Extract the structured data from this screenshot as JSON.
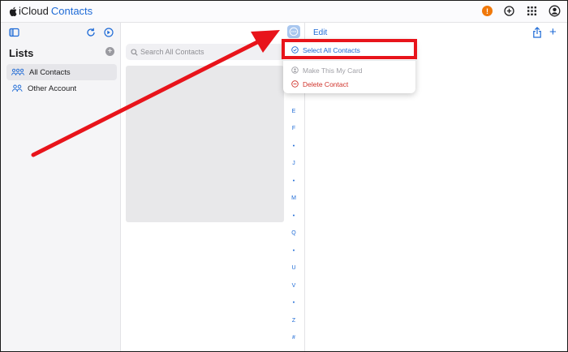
{
  "topbar": {
    "brand_icloud": "iCloud",
    "brand_app": "Contacts",
    "notification_badge": "!",
    "icons": [
      "apple-logo-icon",
      "add-circle-icon",
      "app-grid-icon",
      "account-icon"
    ]
  },
  "sidebar": {
    "lists_title": "Lists",
    "add_list_glyph": "+",
    "items": [
      {
        "label": "All Contacts",
        "selected": true,
        "icon": "people-group-icon"
      },
      {
        "label": "Other Account",
        "selected": false,
        "icon": "people-pair-icon"
      }
    ]
  },
  "contacts": {
    "search_placeholder": "Search All Contacts",
    "index_letters": [
      "E",
      "F",
      "•",
      "J",
      "•",
      "M",
      "•",
      "Q",
      "•",
      "U",
      "V",
      "•",
      "Z",
      "#"
    ]
  },
  "detail": {
    "edit_label": "Edit",
    "add_glyph": "+"
  },
  "menu": {
    "select_all": "Select All Contacts",
    "make_my_card": "Make This My Card",
    "delete_contact": "Delete Contact"
  },
  "colors": {
    "accent": "#1d6ad6",
    "annotation_red": "#e8141b",
    "badge_orange": "#f0780a",
    "delete_red": "#d0342c"
  }
}
